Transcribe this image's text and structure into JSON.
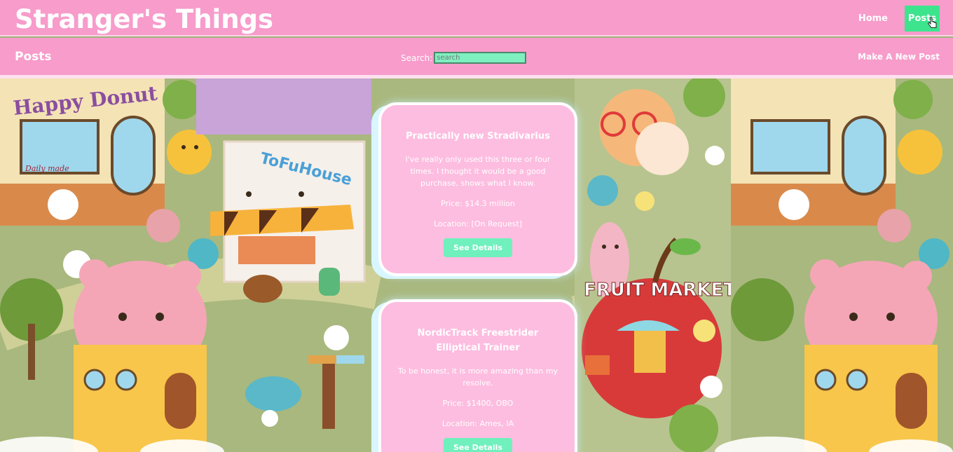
{
  "header": {
    "brand": "Stranger's Things",
    "nav_home": "Home",
    "nav_posts": "Posts"
  },
  "subheader": {
    "title": "Posts",
    "search_label": "Search:",
    "search_placeholder": "search",
    "new_post": "Make A New Post"
  },
  "background": {
    "left_sign": "Happy Donut",
    "left_subsign": "Daily made",
    "center_sign": "ToFuHouse",
    "right_sign": "FRUIT MARKET"
  },
  "posts": [
    {
      "title": "Practically new Stradivarius",
      "description": "I've really only used this three or four times. I thought it would be a good purchase, shows what I know.",
      "price": "Price: $14.3 million",
      "location": "Location: [On Request]",
      "button": "See Details"
    },
    {
      "title": "NordicTrack Freestrider Elliptical Trainer",
      "description": "To be honest, it is more amazing than my resolve.",
      "price": "Price: $1400, OBO",
      "location": "Location: Ames, IA",
      "button": "See Details"
    }
  ],
  "colors": {
    "header_pink": "#f79ccb",
    "card_pink": "#fdbde0",
    "accent_green": "#3de48d",
    "button_green": "#6ff0bd"
  }
}
